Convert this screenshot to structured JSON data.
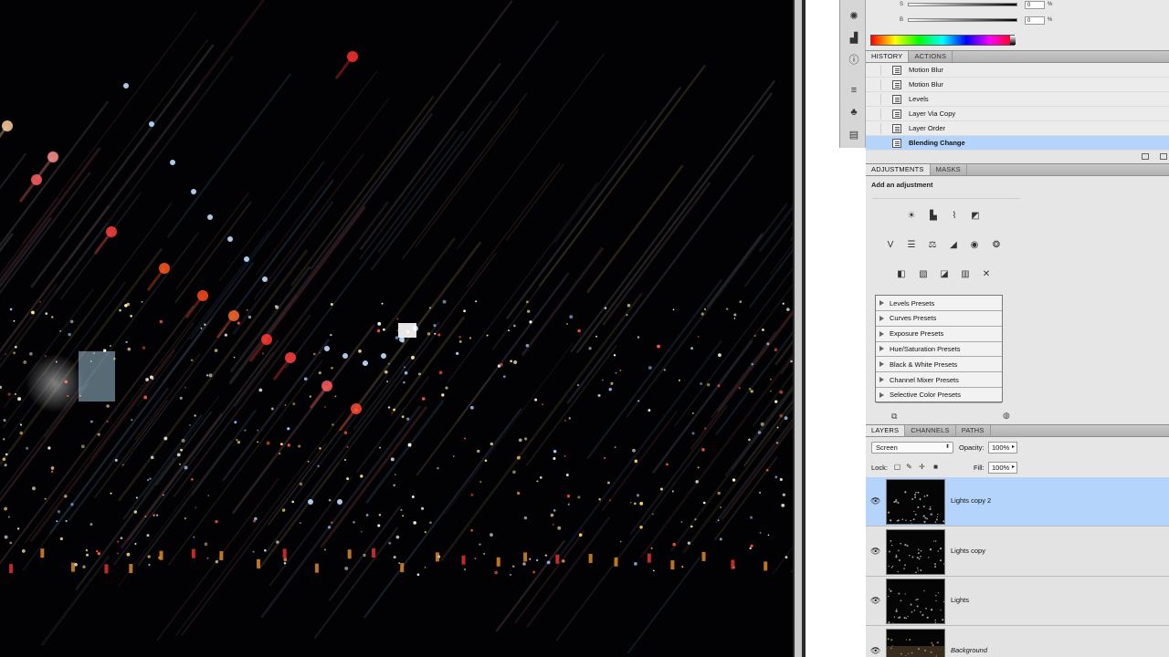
{
  "color_panel": {
    "sliders": [
      {
        "channel": "S",
        "value": "0",
        "unit": "%"
      },
      {
        "channel": "B",
        "value": "0",
        "unit": "%"
      }
    ]
  },
  "history": {
    "tabs": [
      {
        "label": "HISTORY",
        "active": true
      },
      {
        "label": "ACTIONS",
        "active": false
      }
    ],
    "items": [
      {
        "label": "Motion Blur",
        "selected": false
      },
      {
        "label": "Motion Blur",
        "selected": false
      },
      {
        "label": "Levels",
        "selected": false
      },
      {
        "label": "Layer Via Copy",
        "selected": false
      },
      {
        "label": "Layer Order",
        "selected": false
      },
      {
        "label": "Blending Change",
        "selected": true
      }
    ]
  },
  "adjustments": {
    "tabs": [
      {
        "label": "ADJUSTMENTS",
        "active": true
      },
      {
        "label": "MASKS",
        "active": false
      }
    ],
    "title": "Add an adjustment",
    "presets": [
      "Levels Presets",
      "Curves Presets",
      "Exposure Presets",
      "Hue/Saturation Presets",
      "Black & White Presets",
      "Channel Mixer Presets",
      "Selective Color Presets"
    ]
  },
  "layers": {
    "tabs": [
      {
        "label": "LAYERS",
        "active": true
      },
      {
        "label": "CHANNELS",
        "active": false
      },
      {
        "label": "PATHS",
        "active": false
      }
    ],
    "blend_mode": "Screen",
    "opacity_label": "Opacity:",
    "opacity": "100%",
    "lock_label": "Lock:",
    "fill_label": "Fill:",
    "fill": "100%",
    "items": [
      {
        "name": "Lights copy 2",
        "selected": true,
        "italic": false
      },
      {
        "name": "Lights copy",
        "selected": false,
        "italic": false
      },
      {
        "name": "Lights",
        "selected": false,
        "italic": false
      },
      {
        "name": "Background",
        "selected": false,
        "italic": true
      }
    ]
  },
  "colors": {
    "selection": "#b5d4fb",
    "canvas_background": "#020204",
    "panel_background": "#e3e3e3"
  }
}
